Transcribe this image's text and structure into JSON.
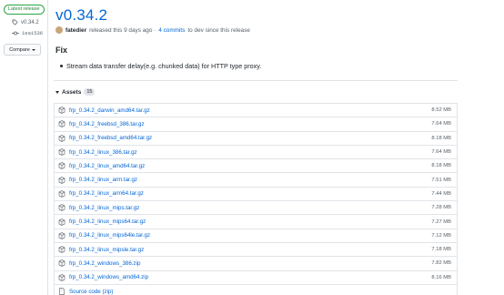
{
  "sidebar": {
    "badge": "Latest release",
    "tag": "v0.34.2",
    "commit": "1ea1536",
    "compare_label": "Compare"
  },
  "release": {
    "title": "v0.34.2",
    "author": "fatedier",
    "released_text": "released this 9 days ago ·",
    "commits_link": "4 commits",
    "commits_suffix": "to dev since this release"
  },
  "notes": {
    "heading": "Fix",
    "items": [
      "Stream data transfer delay(e.g. chunked data) for HTTP type proxy."
    ]
  },
  "assets": {
    "label": "Assets",
    "count": "15",
    "rows": [
      {
        "name": "frp_0.34.2_darwin_amd64.tar.gz",
        "size": "8.52 MB"
      },
      {
        "name": "frp_0.34.2_freebsd_386.tar.gz",
        "size": "7.64 MB"
      },
      {
        "name": "frp_0.34.2_freebsd_amd64.tar.gz",
        "size": "8.18 MB"
      },
      {
        "name": "frp_0.34.2_linux_386.tar.gz",
        "size": "7.64 MB"
      },
      {
        "name": "frp_0.34.2_linux_amd64.tar.gz",
        "size": "8.18 MB"
      },
      {
        "name": "frp_0.34.2_linux_arm.tar.gz",
        "size": "7.51 MB"
      },
      {
        "name": "frp_0.34.2_linux_arm64.tar.gz",
        "size": "7.44 MB"
      },
      {
        "name": "frp_0.34.2_linux_mips.tar.gz",
        "size": "7.28 MB"
      },
      {
        "name": "frp_0.34.2_linux_mips64.tar.gz",
        "size": "7.27 MB"
      },
      {
        "name": "frp_0.34.2_linux_mips64le.tar.gz",
        "size": "7.12 MB"
      },
      {
        "name": "frp_0.34.2_linux_mipsle.tar.gz",
        "size": "7.18 MB"
      },
      {
        "name": "frp_0.34.2_windows_386.zip",
        "size": "7.82 MB"
      },
      {
        "name": "frp_0.34.2_windows_amd64.zip",
        "size": "8.16 MB"
      }
    ],
    "source_label": "Source code (zip)"
  },
  "colors": {
    "link": "#0366d6",
    "badge_green": "#28a745",
    "muted": "#586069"
  },
  "icons": {
    "tag": "tag-icon",
    "commit": "git-commit-icon",
    "package": "package-icon",
    "zip": "file-zip-icon"
  }
}
